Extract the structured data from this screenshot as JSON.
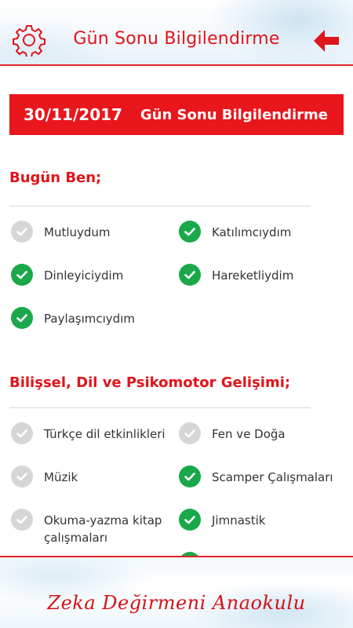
{
  "header": {
    "title": "Gün Sonu Bilgilendirme",
    "settings_icon": "gear-icon",
    "back_icon": "arrow-left-icon"
  },
  "banner": {
    "date": "30/11/2017",
    "title": "Gün Sonu Bilgilendirme"
  },
  "sections": [
    {
      "title": "Bugün Ben;",
      "items": [
        {
          "label": "Mutluydum",
          "checked": false
        },
        {
          "label": "Katılımcıydım",
          "checked": true
        },
        {
          "label": "Dinleyiciydim",
          "checked": true
        },
        {
          "label": "Hareketliydim",
          "checked": true
        },
        {
          "label": "Paylaşımcıydım",
          "checked": true
        }
      ]
    },
    {
      "title": "Bilişsel, Dil ve Psikomotor Gelişimi;",
      "items": [
        {
          "label": "Türkçe dil etkinlikleri",
          "checked": false
        },
        {
          "label": "Fen ve Doğa",
          "checked": false
        },
        {
          "label": "Müzik",
          "checked": false
        },
        {
          "label": "Scamper Çalışmaları",
          "checked": true
        },
        {
          "label": "Okuma-yazma kitap çalışmaları",
          "checked": false
        },
        {
          "label": "Jimnastik",
          "checked": true
        }
      ]
    }
  ],
  "footer": {
    "brand": "Zeka Değirmeni Anaokulu"
  },
  "colors": {
    "accent": "#e9161c",
    "check_on": "#1aa84a",
    "check_off": "#d6d6d6"
  }
}
